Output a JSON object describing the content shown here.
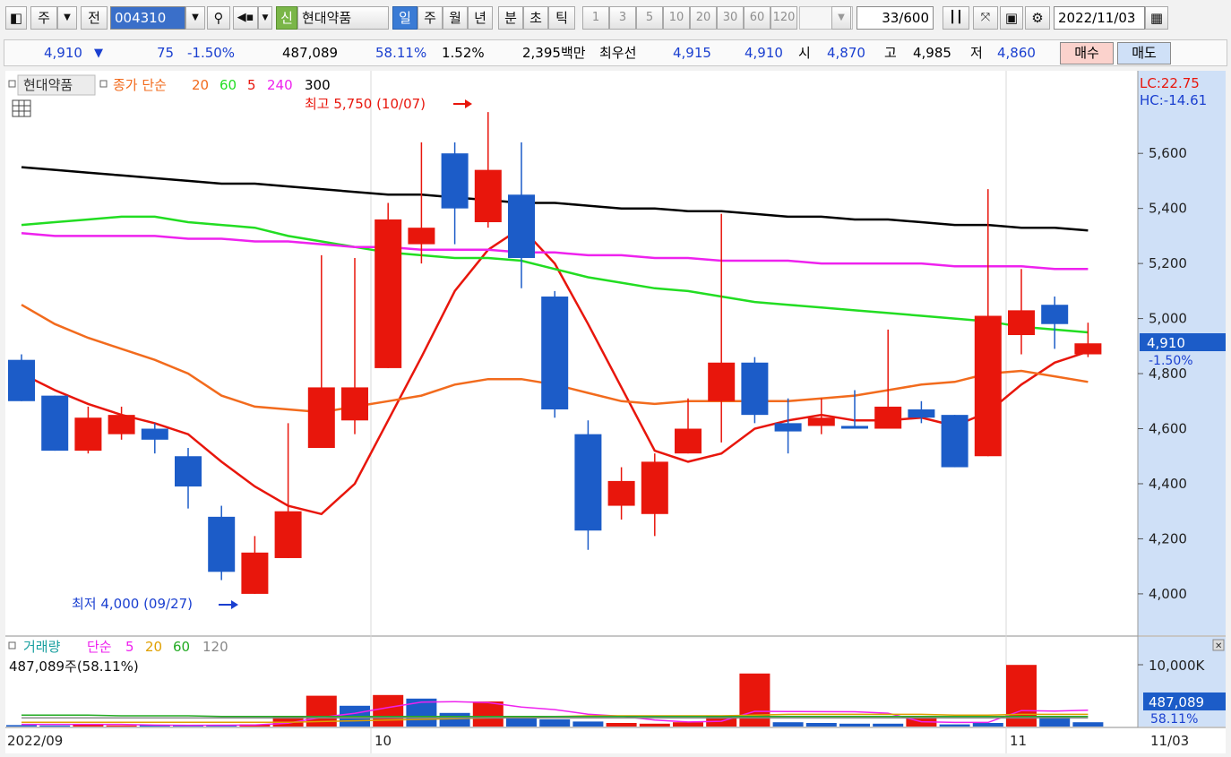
{
  "toolbar": {
    "type_label": "주",
    "prev_label": "전",
    "stock_code": "004310",
    "new_badge": "신",
    "stock_name": "현대약품",
    "period_tabs": [
      "일",
      "주",
      "월",
      "년",
      "분",
      "초",
      "틱"
    ],
    "active_period": "일",
    "intervals": [
      "1",
      "3",
      "5",
      "10",
      "20",
      "30",
      "60",
      "120"
    ],
    "count": "33/600",
    "date": "2022/11/03"
  },
  "info": {
    "price": "4,910",
    "change": "75",
    "change_pct": "-1.50%",
    "volume": "487,089",
    "volume_ratio": "58.11%",
    "turnover": "1.52%",
    "amount": "2,395백만",
    "best_label": "최우선",
    "best_ask": "4,915",
    "best_bid": "4,910",
    "open_label": "시",
    "open": "4,870",
    "high_label": "고",
    "high": "4,985",
    "low_label": "저",
    "low": "4,860",
    "buy_label": "매수",
    "sell_label": "매도"
  },
  "legend": {
    "stock": "현대약품",
    "ma_title": "종가 단순",
    "ma_periods": [
      "20",
      "60",
      "5",
      "240",
      "300"
    ],
    "vol_title": "거래량",
    "vol_ma_title": "단순",
    "vol_ma_periods": [
      "5",
      "20",
      "60",
      "120"
    ],
    "vol_summary": "487,089주(58.11%)"
  },
  "annotations": {
    "lc": "LC:22.75",
    "hc": "HC:-14.61",
    "max_label": "최고 5,750 (10/07)",
    "min_label": "최저 4,000 (09/27)",
    "current_price": "4,910",
    "current_pct": "-1.50%",
    "current_volume": "487,089",
    "current_volume_pct": "58.11%"
  },
  "colors": {
    "up": "#e8160c",
    "down": "#1c5cc8"
  },
  "chart_data": [
    {
      "type": "candlestick",
      "ylim": [
        3850,
        5900
      ],
      "y_ticks": [
        "5,600",
        "5,400",
        "5,200",
        "5,000",
        "4,800",
        "4,600",
        "4,400",
        "4,200",
        "4,000"
      ],
      "x_tick_labels": [
        "2022/09",
        "10",
        "11",
        "11/03"
      ],
      "ohlc": [
        [
          4850,
          4870,
          4700,
          4700
        ],
        [
          4720,
          4720,
          4520,
          4520
        ],
        [
          4520,
          4680,
          4510,
          4640
        ],
        [
          4580,
          4680,
          4560,
          4650
        ],
        [
          4600,
          4620,
          4510,
          4560
        ],
        [
          4500,
          4530,
          4310,
          4390
        ],
        [
          4280,
          4320,
          4050,
          4080
        ],
        [
          4000,
          4210,
          4000,
          4150
        ],
        [
          4130,
          4620,
          4130,
          4300
        ],
        [
          4530,
          5230,
          4530,
          4750
        ],
        [
          4630,
          5220,
          4580,
          4750
        ],
        [
          4820,
          5420,
          4820,
          5360
        ],
        [
          5270,
          5640,
          5200,
          5330
        ],
        [
          5600,
          5640,
          5270,
          5400
        ],
        [
          5350,
          5750,
          5330,
          5540
        ],
        [
          5450,
          5640,
          5110,
          5220
        ],
        [
          5080,
          5100,
          4640,
          4670
        ],
        [
          4580,
          4630,
          4160,
          4230
        ],
        [
          4320,
          4460,
          4270,
          4410
        ],
        [
          4290,
          4510,
          4210,
          4480
        ],
        [
          4510,
          4710,
          4510,
          4600
        ],
        [
          4700,
          5380,
          4550,
          4840
        ],
        [
          4840,
          4860,
          4620,
          4650
        ],
        [
          4620,
          4710,
          4510,
          4590
        ],
        [
          4610,
          4710,
          4580,
          4640
        ],
        [
          4610,
          4740,
          4600,
          4600
        ],
        [
          4600,
          4960,
          4600,
          4680
        ],
        [
          4670,
          4700,
          4620,
          4640
        ],
        [
          4650,
          4650,
          4460,
          4460
        ],
        [
          4500,
          5470,
          4500,
          5010
        ],
        [
          4940,
          5180,
          4870,
          5030
        ],
        [
          5050,
          5080,
          4890,
          4980
        ],
        [
          4870,
          4985,
          4860,
          4910
        ]
      ],
      "ma": [
        {
          "period": "5",
          "color": "#e8160c",
          "values": [
            4800,
            4740,
            4690,
            4650,
            4620,
            4580,
            4480,
            4390,
            4320,
            4290,
            4400,
            4630,
            4860,
            5100,
            5250,
            5330,
            5200,
            4980,
            4750,
            4520,
            4480,
            4510,
            4600,
            4630,
            4650,
            4630,
            4630,
            4640,
            4610,
            4660,
            4760,
            4840,
            4880
          ]
        },
        {
          "period": "20",
          "color": "#f26b1d",
          "values": [
            5050,
            4980,
            4930,
            4890,
            4850,
            4800,
            4720,
            4680,
            4670,
            4660,
            4680,
            4700,
            4720,
            4760,
            4780,
            4780,
            4760,
            4730,
            4700,
            4690,
            4700,
            4700,
            4700,
            4700,
            4710,
            4720,
            4740,
            4760,
            4770,
            4800,
            4810,
            4790,
            4770
          ]
        },
        {
          "period": "60",
          "color": "#22dd22",
          "values": [
            5340,
            5350,
            5360,
            5370,
            5370,
            5350,
            5340,
            5330,
            5300,
            5280,
            5260,
            5240,
            5230,
            5220,
            5220,
            5210,
            5180,
            5150,
            5130,
            5110,
            5100,
            5080,
            5060,
            5050,
            5040,
            5030,
            5020,
            5010,
            5000,
            4990,
            4970,
            4960,
            4950
          ]
        },
        {
          "period": "240",
          "color": "#ee22ee",
          "values": [
            5310,
            5300,
            5300,
            5300,
            5300,
            5290,
            5290,
            5280,
            5280,
            5270,
            5260,
            5260,
            5250,
            5250,
            5250,
            5240,
            5240,
            5230,
            5230,
            5220,
            5220,
            5210,
            5210,
            5210,
            5200,
            5200,
            5200,
            5200,
            5190,
            5190,
            5190,
            5180,
            5180
          ]
        },
        {
          "period": "300",
          "color": "#000000",
          "values": [
            5550,
            5540,
            5530,
            5520,
            5510,
            5500,
            5490,
            5490,
            5480,
            5470,
            5460,
            5450,
            5450,
            5440,
            5430,
            5420,
            5420,
            5410,
            5400,
            5400,
            5390,
            5390,
            5380,
            5370,
            5370,
            5360,
            5360,
            5350,
            5340,
            5340,
            5330,
            5330,
            5320
          ]
        }
      ]
    },
    {
      "type": "bar",
      "title": "거래량",
      "ylim": [
        0,
        12500000
      ],
      "y_ticks": [
        "10,000K"
      ],
      "values": [
        200000,
        150000,
        250000,
        150000,
        200000,
        150000,
        200000,
        300000,
        1500000,
        4300000,
        2900000,
        4400000,
        3900000,
        1900000,
        3500000,
        1500000,
        1000000,
        700000,
        500000,
        400000,
        600000,
        1500000,
        7400000,
        600000,
        500000,
        400000,
        400000,
        1300000,
        300000,
        500000,
        8600000,
        1500000,
        600000
      ],
      "direction": [
        "down",
        "down",
        "up",
        "up",
        "down",
        "down",
        "down",
        "up",
        "up",
        "up",
        "down",
        "up",
        "down",
        "down",
        "up",
        "down",
        "down",
        "down",
        "up",
        "up",
        "up",
        "up",
        "up",
        "down",
        "down",
        "down",
        "down",
        "up",
        "down",
        "down",
        "up",
        "down",
        "down"
      ],
      "ma": [
        {
          "period": "5",
          "color": "#ee22ee",
          "values": [
            300000,
            300000,
            300000,
            300000,
            200000,
            180000,
            190000,
            210000,
            460000,
            1280000,
            1850000,
            2650000,
            3400000,
            3480000,
            3340000,
            2720000,
            2360000,
            1720000,
            1440000,
            900000,
            640000,
            740000,
            2120000,
            2100000,
            2080000,
            2060000,
            1860000,
            680000,
            580000,
            580000,
            2220000,
            2160000,
            2280000
          ]
        },
        {
          "period": "20",
          "color": "#e0a000",
          "values": [
            600000,
            600000,
            600000,
            600000,
            600000,
            600000,
            600000,
            600000,
            600000,
            700000,
            800000,
            900000,
            1000000,
            1100000,
            1200000,
            1300000,
            1400000,
            1500000,
            1500000,
            1500000,
            1500000,
            1500000,
            1600000,
            1700000,
            1700000,
            1700000,
            1700000,
            1700000,
            1600000,
            1600000,
            1700000,
            1700000,
            1700000
          ]
        },
        {
          "period": "60",
          "color": "#22aa22",
          "values": [
            1600000,
            1600000,
            1600000,
            1500000,
            1500000,
            1500000,
            1400000,
            1400000,
            1400000,
            1400000,
            1400000,
            1400000,
            1400000,
            1400000,
            1400000,
            1400000,
            1400000,
            1400000,
            1400000,
            1400000,
            1400000,
            1400000,
            1400000,
            1400000,
            1400000,
            1400000,
            1400000,
            1400000,
            1400000,
            1400000,
            1400000,
            1400000,
            1400000
          ]
        },
        {
          "period": "120",
          "color": "#888888",
          "values": [
            1200000,
            1200000,
            1200000,
            1200000,
            1200000,
            1200000,
            1200000,
            1200000,
            1200000,
            1200000,
            1200000,
            1200000,
            1200000,
            1200000,
            1200000,
            1200000,
            1200000,
            1200000,
            1200000,
            1200000,
            1200000,
            1200000,
            1200000,
            1200000,
            1200000,
            1200000,
            1200000,
            1200000,
            1200000,
            1200000,
            1200000,
            1200000,
            1200000
          ]
        }
      ]
    }
  ]
}
